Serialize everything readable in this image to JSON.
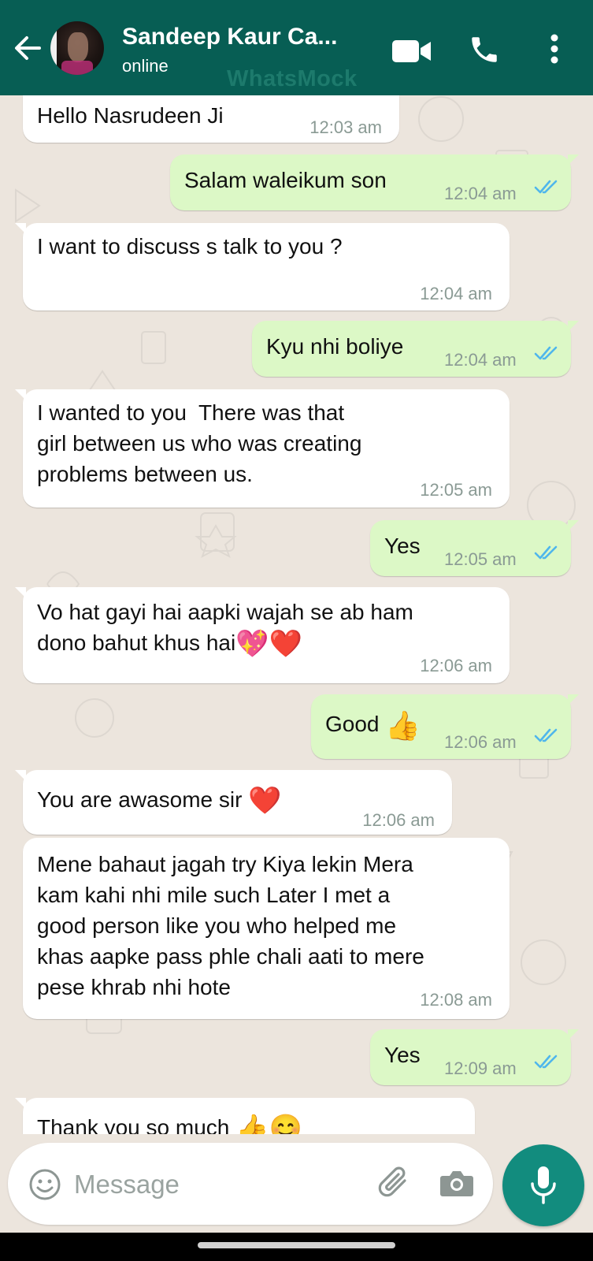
{
  "header": {
    "title": "Sandeep Kaur Ca...",
    "status": "online",
    "watermark": "WhatsMock",
    "colors": {
      "bar": "#075E54",
      "text": "#FFFFFF"
    },
    "icons": [
      "back-arrow-icon",
      "video-call-icon",
      "voice-call-icon",
      "more-options-icon"
    ]
  },
  "messages": [
    {
      "dir": "in",
      "text": "Hello Nasrudeen Ji",
      "time": "12:03 am"
    },
    {
      "dir": "out",
      "text": "Salam waleikum son",
      "time": "12:04 am",
      "read": true
    },
    {
      "dir": "in",
      "text": "I want to discuss s talk to you ?",
      "time": "12:04 am"
    },
    {
      "dir": "out",
      "text": "Kyu nhi boliye",
      "time": "12:04 am",
      "read": true
    },
    {
      "dir": "in",
      "text": "I wanted to you  There was that\ngirl between us who was creating\nproblems between us.",
      "time": "12:05 am"
    },
    {
      "dir": "out",
      "text": "Yes",
      "time": "12:05 am",
      "read": true
    },
    {
      "dir": "in",
      "text": "Vo hat gayi hai aapki wajah se ab ham\ndono bahut khus hai",
      "emoji": "💖❤️",
      "time": "12:06 am"
    },
    {
      "dir": "out",
      "text": "Good",
      "emoji": "👍",
      "time": "12:06 am",
      "read": true
    },
    {
      "dir": "in",
      "text": "You are awasome sir",
      "emoji": "❤️",
      "time": "12:06 am"
    },
    {
      "dir": "in",
      "text": "Mene bahaut jagah try Kiya lekin Mera\nkam kahi nhi mile such Later I met a\ngood person like you who helped me\nkhas aapke pass phle chali aati to mere\npese khrab nhi hote",
      "time": "12:08 am"
    },
    {
      "dir": "out",
      "text": "Yes",
      "time": "12:09 am",
      "read": true
    },
    {
      "dir": "in",
      "text": "Thank you so much",
      "emoji": "👍😊",
      "time": ""
    }
  ],
  "composer": {
    "placeholder": "Message",
    "icons": [
      "emoji-icon",
      "attach-icon",
      "camera-icon",
      "mic-icon"
    ]
  },
  "colors": {
    "chat_bg": "#ECE5DD",
    "incoming": "#FFFFFF",
    "outgoing": "#DCF8C6",
    "read_tick": "#4FB6EC",
    "accent": "#128C7E"
  }
}
